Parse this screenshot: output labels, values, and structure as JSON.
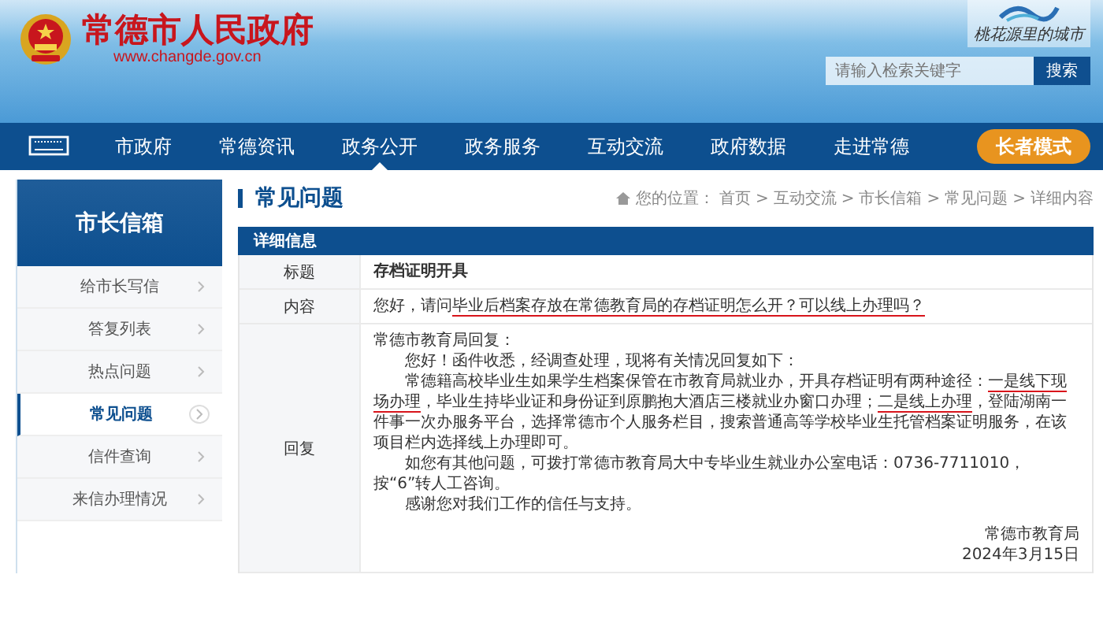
{
  "header": {
    "site_title": "常德市人民政府",
    "site_url": "www.changde.gov.cn",
    "slogan": "桃花源里的城市",
    "search": {
      "placeholder": "请输入检索关键字",
      "button": "搜索"
    }
  },
  "nav": {
    "items": [
      {
        "label": "市政府",
        "selected": false
      },
      {
        "label": "常德资讯",
        "selected": false
      },
      {
        "label": "政务公开",
        "selected": true
      },
      {
        "label": "政务服务",
        "selected": false
      },
      {
        "label": "互动交流",
        "selected": false
      },
      {
        "label": "政府数据",
        "selected": false
      },
      {
        "label": "走进常德",
        "selected": false
      }
    ],
    "elder_mode": "长者模式"
  },
  "sidebar": {
    "title": "市长信箱",
    "items": [
      {
        "label": "给市长写信",
        "selected": false
      },
      {
        "label": "答复列表",
        "selected": false
      },
      {
        "label": "热点问题",
        "selected": false
      },
      {
        "label": "常见问题",
        "selected": true
      },
      {
        "label": "信件查询",
        "selected": false
      },
      {
        "label": "来信办理情况",
        "selected": false
      }
    ]
  },
  "page_title": "常见问题",
  "breadcrumb": {
    "prefix": "您的位置：",
    "items": [
      "首页",
      "互动交流",
      "市长信箱",
      "常见问题",
      "详细内容"
    ],
    "separator": ">"
  },
  "detail": {
    "heading": "详细信息",
    "title_label": "标题",
    "title_value": "存档证明开具",
    "content_label": "内容",
    "content_segments": [
      {
        "text": "您好，请问",
        "marked": false
      },
      {
        "text": "毕业后档案存放在常德教育局的存档证明怎么开？可以线上办理吗？",
        "marked": true
      }
    ],
    "reply_label": "回复",
    "reply_paragraphs": [
      {
        "indent": false,
        "segments": [
          {
            "text": "常德市教育局回复：",
            "marked": false
          }
        ]
      },
      {
        "indent": true,
        "segments": [
          {
            "text": "您好！函件收悉，经调查处理，现将有关情况回复如下：",
            "marked": false
          }
        ]
      },
      {
        "indent": true,
        "segments": [
          {
            "text": "常德籍高校毕业生如果学生档案保管在市教育局就业办，开具存档证明有两种途径：",
            "marked": false
          },
          {
            "text": "一是线下现场办理",
            "marked": true
          },
          {
            "text": "，毕业生持毕业证和身份证到原鹏抱大酒店三楼就业办窗口办理；",
            "marked": false
          },
          {
            "text": "二是线上办理",
            "marked": true
          },
          {
            "text": "，登陆湖南一件事一次办服务平台，选择常德市个人服务栏目，搜索普通高等学校毕业生托管档案证明服务，在该项目栏内选择线上办理即可。",
            "marked": false
          }
        ]
      },
      {
        "indent": true,
        "segments": [
          {
            "text": "如您有其他问题，可拨打常德市教育局大中专毕业生就业办公室电话：0736-7711010，按“6”转人工咨询。",
            "marked": false
          }
        ]
      },
      {
        "indent": true,
        "segments": [
          {
            "text": "感谢您对我们工作的信任与支持。",
            "marked": false
          }
        ]
      }
    ],
    "signature": "常德市教育局",
    "date": "2024年3月15日"
  }
}
